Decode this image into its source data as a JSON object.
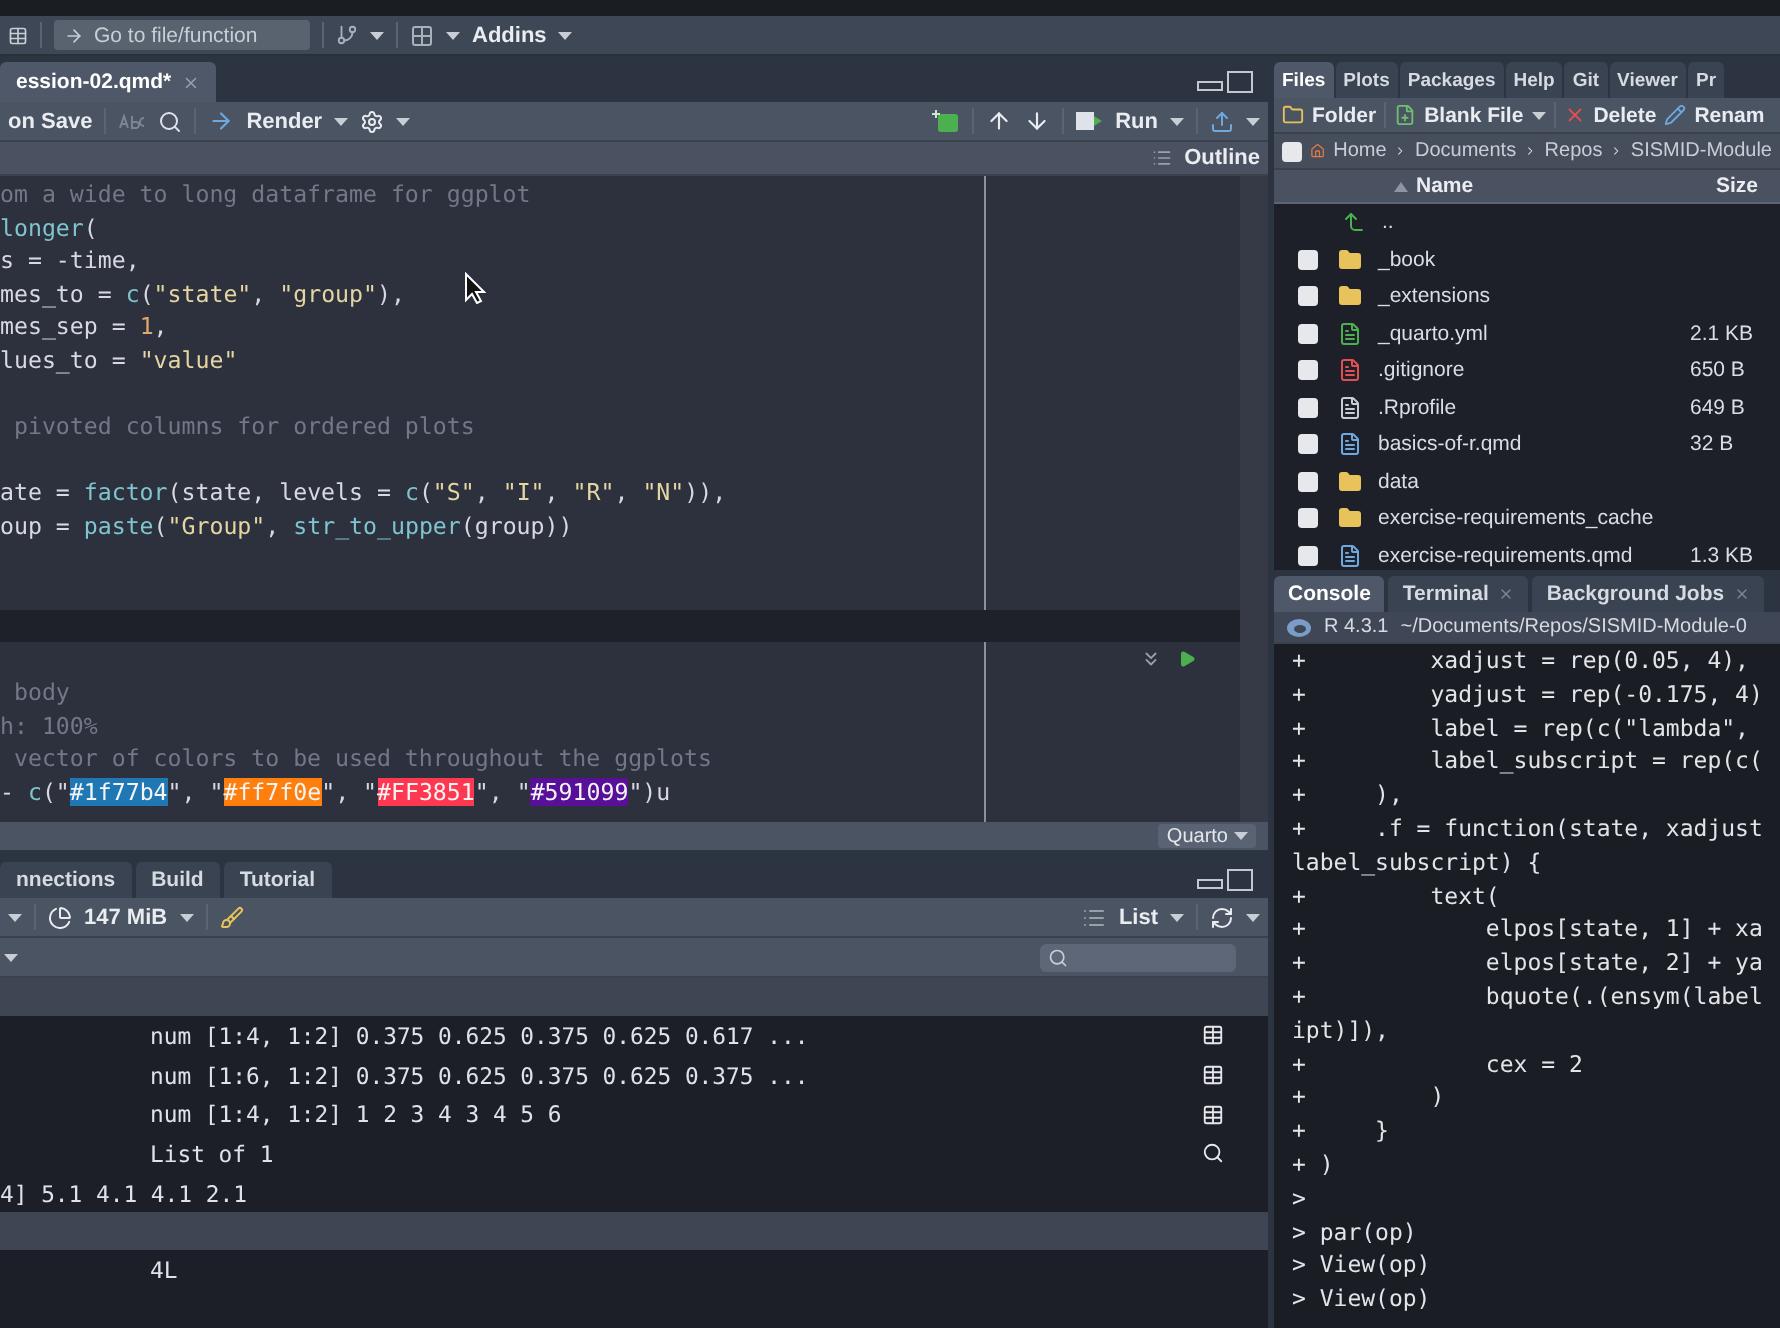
{
  "main_toolbar": {
    "goto_placeholder": "Go to file/function",
    "addins": "Addins"
  },
  "source": {
    "tab": {
      "label": "ession-02.qmd*",
      "selected": true
    },
    "toolbar": {
      "save_label": "on Save",
      "render": "Render",
      "run": "Run"
    },
    "outline": "Outline",
    "lines": [
      {
        "kind": "code",
        "tokens": [
          {
            "kind": "comment",
            "text": "om a wide to long dataframe for ggplot"
          }
        ]
      },
      {
        "kind": "code",
        "tokens": [
          {
            "kind": "func",
            "text": "longer"
          },
          {
            "kind": "plain",
            "text": "("
          }
        ]
      },
      {
        "kind": "code",
        "tokens": [
          {
            "kind": "plain",
            "text": "s = -time,"
          }
        ]
      },
      {
        "kind": "code",
        "tokens": [
          {
            "kind": "plain",
            "text": "mes_to = "
          },
          {
            "kind": "func",
            "text": "c"
          },
          {
            "kind": "plain",
            "text": "("
          },
          {
            "kind": "string",
            "text": "\"state\""
          },
          {
            "kind": "plain",
            "text": ", "
          },
          {
            "kind": "string",
            "text": "\"group\""
          },
          {
            "kind": "plain",
            "text": "),"
          }
        ]
      },
      {
        "kind": "code",
        "tokens": [
          {
            "kind": "plain",
            "text": "mes_sep = "
          },
          {
            "kind": "number",
            "text": "1"
          },
          {
            "kind": "plain",
            "text": ","
          }
        ]
      },
      {
        "kind": "code",
        "tokens": [
          {
            "kind": "plain",
            "text": "lues_to = "
          },
          {
            "kind": "string",
            "text": "\"value\""
          }
        ]
      },
      {
        "kind": "blank"
      },
      {
        "kind": "code",
        "tokens": [
          {
            "kind": "comment",
            "text": " pivoted columns for ordered plots"
          }
        ]
      },
      {
        "kind": "blank"
      },
      {
        "kind": "code",
        "tokens": [
          {
            "kind": "plain",
            "text": "ate = "
          },
          {
            "kind": "func",
            "text": "factor"
          },
          {
            "kind": "plain",
            "text": "(state, levels = "
          },
          {
            "kind": "func",
            "text": "c"
          },
          {
            "kind": "plain",
            "text": "("
          },
          {
            "kind": "string",
            "text": "\"S\""
          },
          {
            "kind": "plain",
            "text": ", "
          },
          {
            "kind": "string",
            "text": "\"I\""
          },
          {
            "kind": "plain",
            "text": ", "
          },
          {
            "kind": "string",
            "text": "\"R\""
          },
          {
            "kind": "plain",
            "text": ", "
          },
          {
            "kind": "string",
            "text": "\"N\""
          },
          {
            "kind": "plain",
            "text": ")),"
          }
        ]
      },
      {
        "kind": "code",
        "tokens": [
          {
            "kind": "plain",
            "text": "oup = "
          },
          {
            "kind": "func",
            "text": "paste"
          },
          {
            "kind": "plain",
            "text": "("
          },
          {
            "kind": "string",
            "text": "\"Group\""
          },
          {
            "kind": "plain",
            "text": ", "
          },
          {
            "kind": "func",
            "text": "str_to_upper"
          },
          {
            "kind": "plain",
            "text": "(group))"
          }
        ]
      },
      {
        "kind": "blank"
      },
      {
        "kind": "blank"
      },
      {
        "kind": "chunk_end"
      },
      {
        "kind": "chunk_start"
      },
      {
        "kind": "code",
        "tokens": [
          {
            "kind": "comment",
            "text": " body"
          }
        ]
      },
      {
        "kind": "code",
        "tokens": [
          {
            "kind": "comment",
            "text": "h: 100%"
          }
        ]
      },
      {
        "kind": "code",
        "tokens": [
          {
            "kind": "comment",
            "text": " vector of colors to be used throughout the ggplots"
          }
        ]
      },
      {
        "kind": "code",
        "tokens": [
          {
            "kind": "plain",
            "text": "- "
          },
          {
            "kind": "func",
            "text": "c"
          },
          {
            "kind": "plain",
            "text": "(\""
          },
          {
            "kind": "hex",
            "text": "#1f77b4",
            "color": "#1f77b4"
          },
          {
            "kind": "plain",
            "text": "\", \""
          },
          {
            "kind": "hex",
            "text": "#ff7f0e",
            "color": "#ff7f0e"
          },
          {
            "kind": "plain",
            "text": "\", \""
          },
          {
            "kind": "hex",
            "text": "#FF3851",
            "color": "#ff3851"
          },
          {
            "kind": "plain",
            "text": "\", \""
          },
          {
            "kind": "hex",
            "text": "#591099",
            "color": "#591099"
          },
          {
            "kind": "plain",
            "text": "\")u"
          }
        ]
      }
    ],
    "status": "Quarto"
  },
  "bottom_pane": {
    "tabs": [
      {
        "label": "nnections",
        "selected": false
      },
      {
        "label": "Build",
        "selected": false
      },
      {
        "label": "Tutorial",
        "selected": false
      }
    ],
    "memory": "147 MiB",
    "view_mode": "List",
    "rows": [
      {
        "kind": "header"
      },
      {
        "kind": "data",
        "value": "num [1:4, 1:2] 0.375 0.625 0.375 0.625 0.617 ..."
      },
      {
        "kind": "data",
        "value": "num [1:6, 1:2] 0.375 0.625 0.375 0.625 0.375 ..."
      },
      {
        "kind": "data",
        "value": "num [1:4, 1:2] 1 2 3 4 3 4 5 6"
      },
      {
        "kind": "list",
        "value": "List of  1"
      },
      {
        "kind": "continued",
        "value": "4] 5.1 4.1 4.1 2.1"
      },
      {
        "kind": "header"
      },
      {
        "kind": "plain",
        "value": "4L"
      }
    ]
  },
  "files": {
    "tabs": [
      {
        "label": "Files",
        "selected": true
      },
      {
        "label": "Plots",
        "selected": false
      },
      {
        "label": "Packages",
        "selected": false
      },
      {
        "label": "Help",
        "selected": false
      },
      {
        "label": "Git",
        "selected": false
      },
      {
        "label": "Viewer",
        "selected": false
      },
      {
        "label": "Pr",
        "selected": false
      }
    ],
    "toolbar": {
      "folder": "Folder",
      "blank_file": "Blank File",
      "delete": "Delete",
      "rename": "Renam"
    },
    "select_all": {
      "checked": false
    },
    "breadcrumb": [
      "Home",
      "Documents",
      "Repos",
      "SISMID-Module"
    ],
    "columns": {
      "name": "Name",
      "size": "Size"
    },
    "items": [
      {
        "kind": "parent",
        "name": ".."
      },
      {
        "kind": "folder",
        "name": "_book",
        "checked": false
      },
      {
        "kind": "folder",
        "name": "_extensions",
        "checked": false
      },
      {
        "kind": "yaml",
        "name": "_quarto.yml",
        "size": "2.1 KB",
        "checked": false
      },
      {
        "kind": "git",
        "name": ".gitignore",
        "size": "650 B",
        "checked": false
      },
      {
        "kind": "r",
        "name": ".Rprofile",
        "size": "649 B",
        "checked": false
      },
      {
        "kind": "qmd",
        "name": "basics-of-r.qmd",
        "size": "32 B",
        "checked": false
      },
      {
        "kind": "folder",
        "name": "data",
        "checked": false
      },
      {
        "kind": "folder",
        "name": "exercise-requirements_cache",
        "checked": false
      },
      {
        "kind": "qmd",
        "name": "exercise-requirements.qmd",
        "size": "1.3 KB",
        "checked": false
      }
    ]
  },
  "console": {
    "tabs": [
      {
        "label": "Console",
        "selected": true,
        "closable": false
      },
      {
        "label": "Terminal",
        "selected": false,
        "closable": true
      },
      {
        "label": "Background Jobs",
        "selected": false,
        "closable": true
      }
    ],
    "version": "R 4.3.1",
    "path": "~/Documents/Repos/SISMID-Module-0",
    "lines": [
      "+         xadjust = rep(0.05, 4),",
      "+         yadjust = rep(-0.175, 4)",
      "+         label = rep(c(\"lambda\",",
      "+         label_subscript = rep(c(",
      "+     ),",
      "+     .f = function(state, xadjust",
      "label_subscript) {",
      "+         text(",
      "+             elpos[state, 1] + xa",
      "+             elpos[state, 2] + ya",
      "+             bquote(.(ensym(label",
      "ipt)]),",
      "+             cex = 2",
      "+         )",
      "+     }",
      "+ )",
      ">",
      "> par(op)",
      "> View(op)",
      "> View(op)"
    ]
  }
}
